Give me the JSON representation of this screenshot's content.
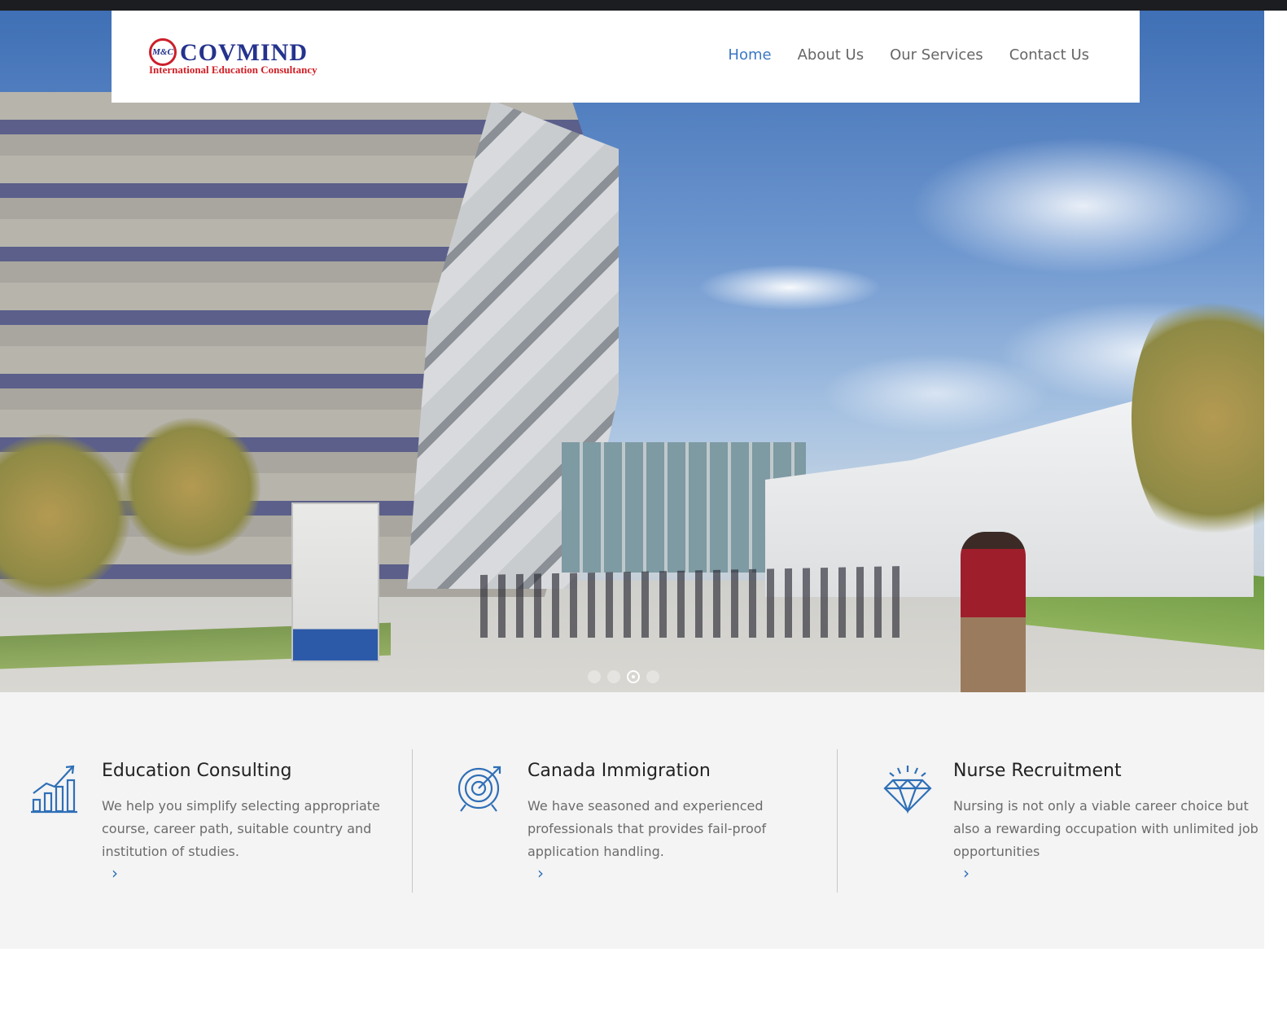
{
  "brand": {
    "logo_mark": "M&C",
    "name": "COVMIND",
    "tagline": "International Education Consultancy"
  },
  "nav": {
    "items": [
      {
        "label": "Home",
        "active": true
      },
      {
        "label": "About Us",
        "active": false
      },
      {
        "label": "Our Services",
        "active": false
      },
      {
        "label": "Contact Us",
        "active": false
      }
    ]
  },
  "hero": {
    "slider": {
      "total_slides": 4,
      "active_slide": 3
    }
  },
  "features": [
    {
      "icon": "bar-chart-growth-icon",
      "title": "Education Consulting",
      "text": "We help you simplify selecting appropriate course, career path, suitable country and institution of studies.",
      "more_icon": "chevron-right-icon"
    },
    {
      "icon": "target-icon",
      "title": "Canada Immigration",
      "text": "We have seasoned and experienced professionals that provides fail-proof application handling.",
      "more_icon": "chevron-right-icon"
    },
    {
      "icon": "diamond-icon",
      "title": "Nurse Recruitment",
      "text": "Nursing is not only a viable career choice but also a rewarding occupation with unlimited job opportunities",
      "more_icon": "chevron-right-icon"
    }
  ],
  "colors": {
    "accent": "#3a78c3",
    "icon_blue": "#2f6fb7",
    "logo_blue": "#24338d",
    "logo_red": "#d11d24",
    "top_bar": "#1c1d20",
    "features_bg": "#f4f4f4"
  }
}
